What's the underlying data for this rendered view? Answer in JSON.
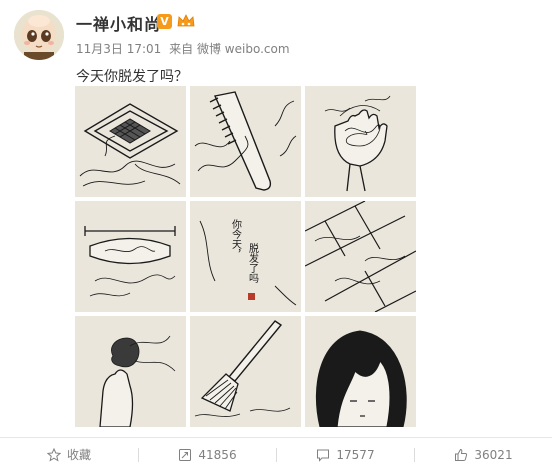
{
  "user": {
    "name": "一禅小和尚",
    "verified_badge": "V"
  },
  "meta": {
    "date": "11月3日 17:01",
    "source_prefix": "来自",
    "source": "微博 weibo.com"
  },
  "post": {
    "text": "今天你脱发了吗？"
  },
  "image_text": {
    "line1": "你今天，",
    "line2": "脱发了吗"
  },
  "actions": {
    "favorite_label": "收藏",
    "repost_count": "41856",
    "comment_count": "17577",
    "like_count": "36021"
  },
  "colors": {
    "badge": "#f59a1b",
    "panel_bg": "#eae6dc",
    "ink": "#1a1a1a",
    "meta": "#808080"
  },
  "icons": [
    "star-icon",
    "repost-icon",
    "comment-icon",
    "like-icon",
    "crown-icon"
  ]
}
